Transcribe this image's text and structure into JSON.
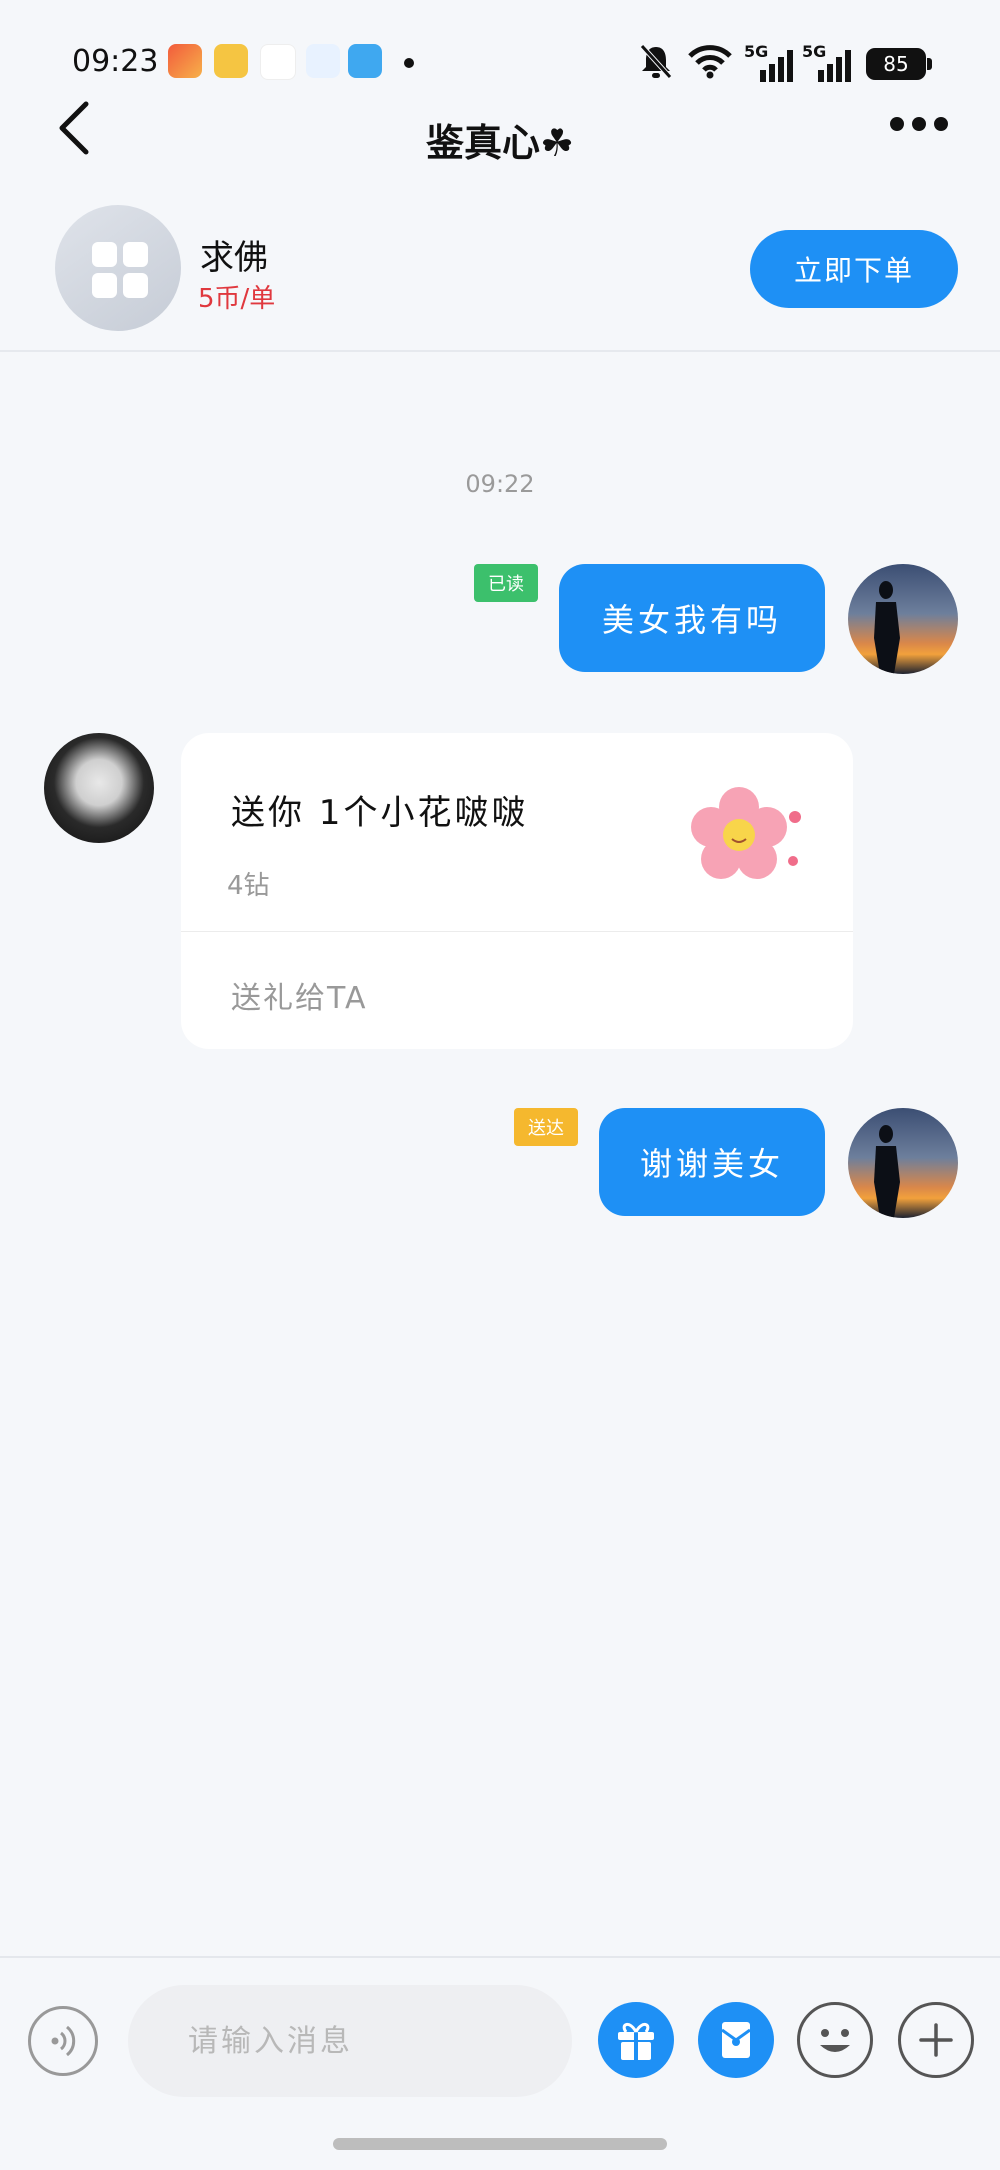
{
  "status_bar": {
    "time": "09:23",
    "network_1": "5G",
    "network_2": "5G",
    "battery": "85"
  },
  "nav": {
    "title": "鉴真心",
    "title_suffix": "☘"
  },
  "service": {
    "name": "求佛",
    "price": "5币/单",
    "order_button": "立即下单"
  },
  "chat": {
    "timestamp": "09:22",
    "messages": [
      {
        "sender": "self",
        "text": "美女我有吗",
        "status": "已读",
        "status_color": "#3cc06c"
      },
      {
        "sender": "other",
        "type": "gift",
        "text": "送你 1个小花啵啵",
        "cost": "4钻",
        "action": "送礼给TA"
      },
      {
        "sender": "self",
        "text": "谢谢美女",
        "status": "送达",
        "status_color": "#f5b82e"
      }
    ]
  },
  "input_bar": {
    "placeholder": "请输入消息"
  },
  "colors": {
    "accent": "#1e90f5",
    "price_red": "#e0383e"
  }
}
